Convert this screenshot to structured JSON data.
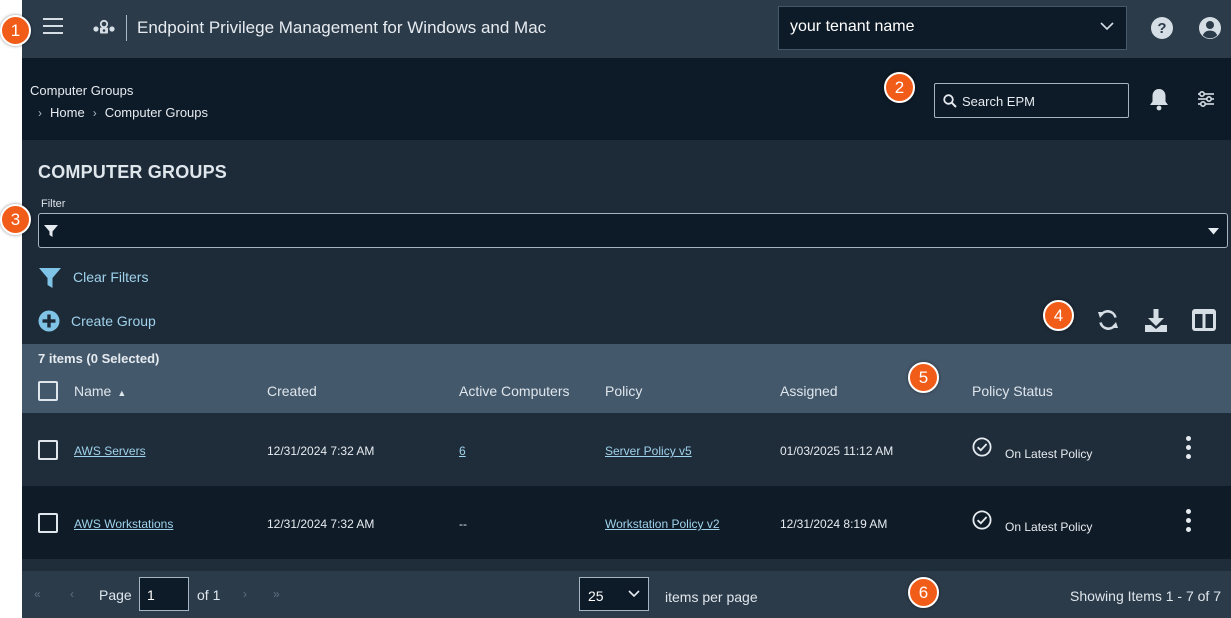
{
  "app": {
    "title": "Endpoint Privilege Management for Windows and Mac",
    "tenant": "your tenant name",
    "logo": "beyondtrust-logo-icon",
    "icons": [
      "menu-icon",
      "help-icon",
      "account-icon",
      "bell-icon",
      "settings-icon",
      "search-icon"
    ]
  },
  "header": {
    "crumb_title": "Computer Groups",
    "breadcrumb": [
      "Home",
      "Computer Groups"
    ],
    "search_placeholder": "Search EPM"
  },
  "page": {
    "title": "COMPUTER GROUPS",
    "filter_label": "Filter",
    "clear_filters": "Clear Filters",
    "create_group": "Create Group"
  },
  "table": {
    "items_count": "7 items (0 Selected)",
    "columns": [
      "Name",
      "Created",
      "Active Computers",
      "Policy",
      "Assigned",
      "Policy Status"
    ],
    "sort": "ascending",
    "rows": [
      {
        "name": "AWS Servers",
        "created": "12/31/2024 7:32 AM",
        "active": "6",
        "policy": "Server Policy v5",
        "assigned": "01/03/2025 11:12 AM",
        "status": "On Latest Policy"
      },
      {
        "name": "AWS Workstations",
        "created": "12/31/2024 7:32 AM",
        "active": "--",
        "policy": "Workstation Policy v2",
        "assigned": "12/31/2024 8:19 AM",
        "status": "On Latest Policy"
      }
    ]
  },
  "pagination": {
    "page_label": "Page",
    "page_value": "1",
    "of_label": "of 1",
    "per_page": "25",
    "per_page_label": "items per page",
    "showing": "Showing Items 1 - 7 of 7",
    "nav_glyphs": [
      "«",
      "‹",
      "›",
      "»"
    ]
  },
  "callouts": [
    "1",
    "2",
    "3",
    "4",
    "5",
    "6"
  ],
  "colors": {
    "topbar": "#2c3b4a",
    "header": "#0d1a27",
    "panel": "#1d2a37",
    "table_head": "#44586b",
    "link": "#9fd3ec",
    "callout": "#f25c19"
  }
}
